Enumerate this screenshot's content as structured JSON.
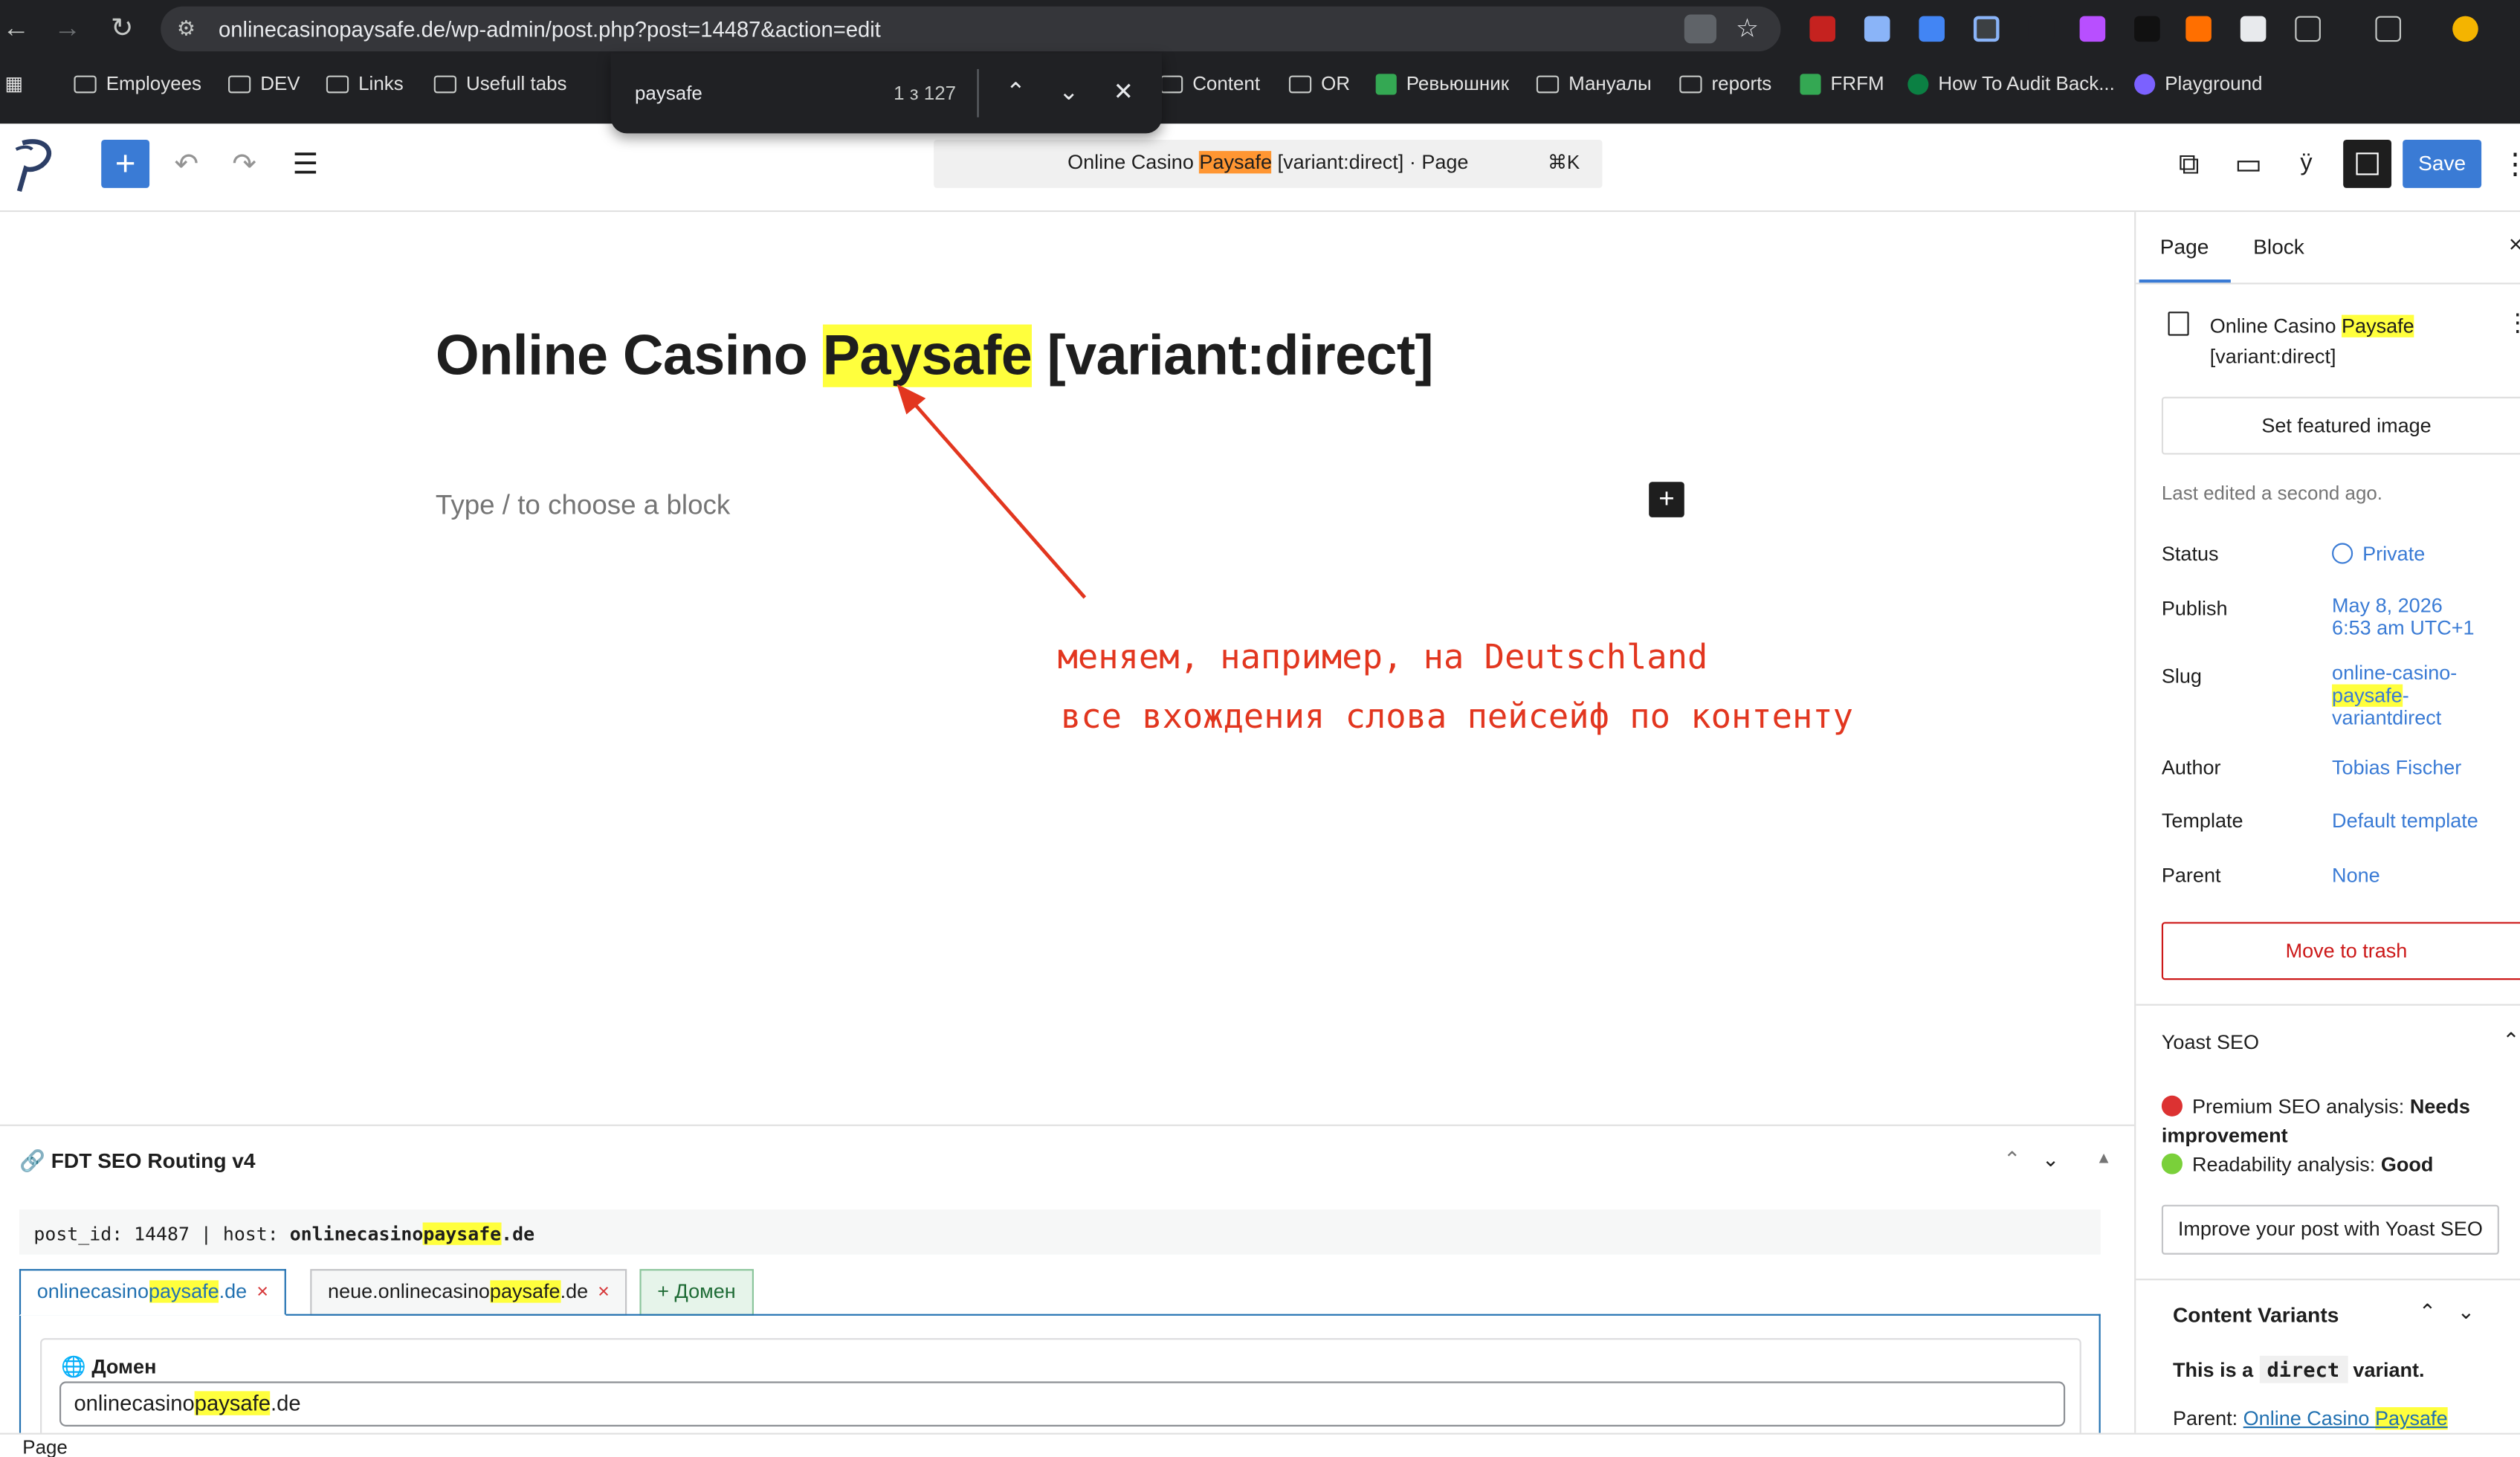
{
  "browser": {
    "url": "onlinecasinopaysafe.de/wp-admin/post.php?post=14487&action=edit",
    "bookmarks": [
      "Employees",
      "DEV",
      "Links",
      "Usefull tabs",
      "Content",
      "OR",
      "Ревьюшник",
      "Мануалы",
      "reports",
      "FRFM",
      "How To Audit Back...",
      "Playground"
    ],
    "find": {
      "query": "paysafe",
      "count": "1 з 127"
    }
  },
  "editor": {
    "doc_title_pre": "Online Casino ",
    "doc_title_hl": "Paysafe",
    "doc_title_post": " [variant:direct]",
    "doc_type": "· Page",
    "shortcut": "⌘K",
    "save_label": "Save",
    "title_pre": "Online Casino ",
    "title_hl": "Paysafe",
    "title_post": " [variant:direct]",
    "placeholder": "Type / to choose a block"
  },
  "annotation": {
    "line1": "меняем, например, на Deutschland",
    "line2": "все вхождения слова пейсейф по контенту",
    "color": "#e2361f"
  },
  "metabox": {
    "title": "🔗 FDT SEO Routing v4",
    "info_a": "post_id: 14487 | host: ",
    "info_b": "onlinecasino",
    "info_hl": "paysafe",
    "info_c": ".de",
    "tabs": [
      {
        "a": "onlinecasino",
        "hl": "paysafe",
        "b": ".de",
        "close": "×"
      },
      {
        "a": "neue.onlinecasino",
        "hl": "paysafe",
        "b": ".de",
        "close": "×"
      }
    ],
    "add_tab": "+ Домен",
    "domain_label": "🌐 Домен",
    "domain_a": "onlinecasino",
    "domain_hl": "paysafe",
    "domain_b": ".de"
  },
  "status_bar": "Page",
  "sidebar": {
    "tab_page": "Page",
    "tab_block": "Block",
    "summary_pre": "Online Casino ",
    "summary_hl": "Paysafe",
    "summary_post": "[variant:direct]",
    "featured": "Set featured image",
    "last_edited": "Last edited a second ago.",
    "status_l": "Status",
    "status_v": "Private",
    "publish_l": "Publish",
    "publish_v1": "May 8, 2026",
    "publish_v2": "6:53 am UTC+1",
    "slug_l": "Slug",
    "slug_v1": "online-casino-",
    "slug_hl": "paysafe",
    "slug_dash": "-",
    "slug_v2": "variantdirect",
    "author_l": "Author",
    "author_v": "Tobias Fischer",
    "template_l": "Template",
    "template_v": "Default template",
    "parent_l": "Parent",
    "parent_v": "None",
    "trash": "Move to trash",
    "yoast_title": "Yoast SEO",
    "yoast_premium_a": "Premium SEO analysis: ",
    "yoast_premium_b": "Needs improvement",
    "yoast_read_a": "Readability analysis: ",
    "yoast_read_b": "Good",
    "yoast_btn": "Improve your post with Yoast SEO",
    "cv_title": "Content Variants",
    "cv_a": "This is a ",
    "cv_code": "direct",
    "cv_b": " variant.",
    "cv_parent_l": "Parent: ",
    "cv_parent_a": "Online Casino ",
    "cv_parent_hl": "Paysafe"
  }
}
